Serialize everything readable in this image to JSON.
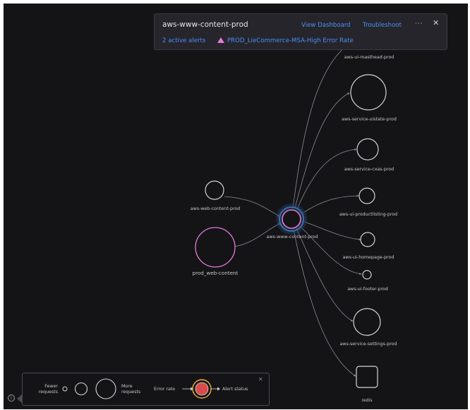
{
  "popover": {
    "title": "aws-www-content-prod",
    "view_dashboard": "View Dashboard",
    "troubleshoot": "Troubleshoot",
    "more": "···",
    "close": "✕",
    "alerts_count": "2 active alerts",
    "alert_name": "PROD_LieCommerce-MSA-High Error Rate",
    "alert_color": "#e87bd6"
  },
  "nodes": {
    "web_content": "aws-web-content-prod",
    "prod_web_content": "prod_web-content",
    "center": "aws-www-content-prod",
    "masthead": "aws-ui-masthead-prod",
    "uistate": "aws-service-uistate-prod",
    "cxas": "aws-service-cxas-prod",
    "productlisting": "aws-ui-productlisting-prod",
    "homepage": "aws-ui-homepage-prod",
    "footer": "aws-ui-footer-prod",
    "settings": "aws-service-settings-prod",
    "redis": "redis"
  },
  "legend": {
    "fewer": "Fewer\nrequests",
    "more": "More\nrequests",
    "error_rate": "Error rate",
    "alert_status": "Alert status",
    "close": "✕",
    "info": "i"
  },
  "colors": {
    "background": "#141417",
    "node_stroke": "#d4d4d8",
    "edge": "#8c8c94",
    "alert_pink": "#e87bd6",
    "selected_glow": "#2b4e78",
    "error_fill": "#d94c4c",
    "alert_ring": "#f2b43a",
    "link": "#4f8ff7"
  }
}
